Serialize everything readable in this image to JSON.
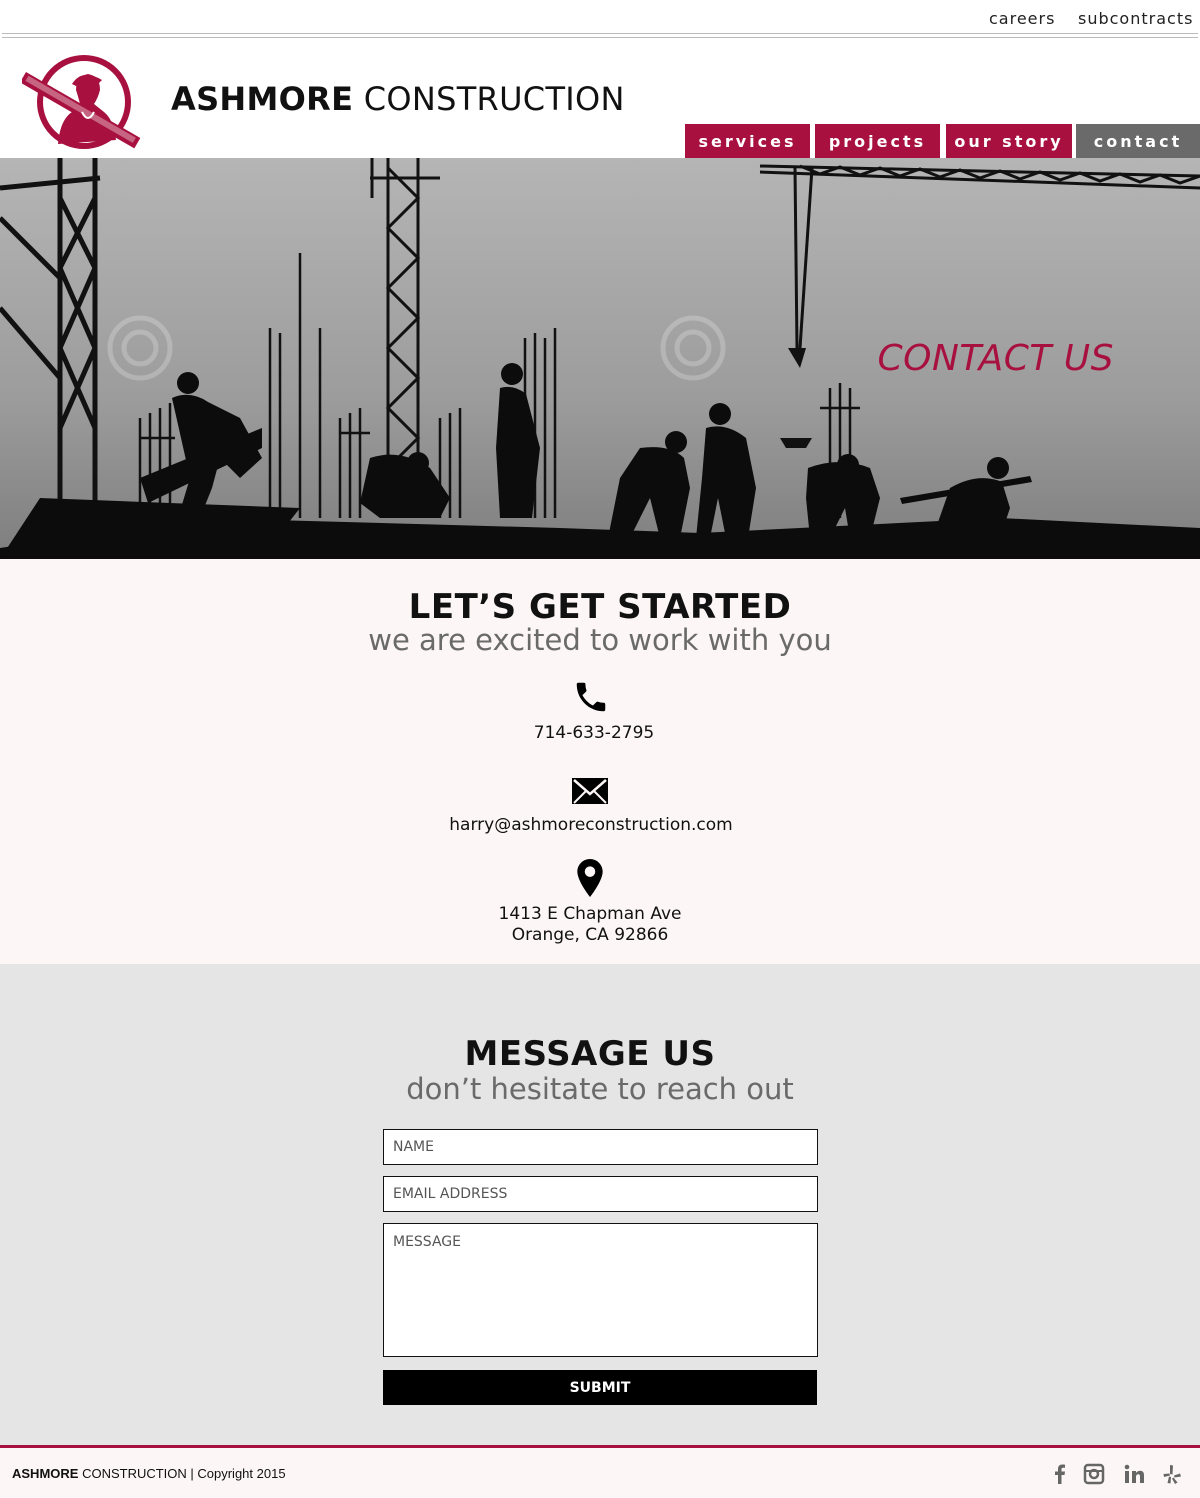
{
  "topbar": {
    "careers": "careers",
    "subcontracts": "subcontracts"
  },
  "header": {
    "brand_bold": "ASHMORE",
    "brand_light": " CONSTRUCTION"
  },
  "nav": {
    "items": [
      {
        "label": "services"
      },
      {
        "label": "projects"
      },
      {
        "label": "our story"
      },
      {
        "label": "contact"
      }
    ],
    "active": "contact"
  },
  "hero": {
    "title": "CONTACT US"
  },
  "contact": {
    "title": "LET’S GET STARTED",
    "subtitle": "we are excited to work with you",
    "phone": "714-633-2795",
    "email": "harry@ashmoreconstruction.com",
    "address_line1": "1413 E Chapman Ave",
    "address_line2": "Orange, CA 92866"
  },
  "message": {
    "title": "MESSAGE US",
    "subtitle": "don’t hesitate to reach out",
    "name_placeholder": "NAME",
    "email_placeholder": "EMAIL ADDRESS",
    "message_placeholder": "MESSAGE",
    "submit_label": "SUBMIT"
  },
  "footer": {
    "brand_bold": "ASHMORE",
    "brand_rest": " CONSTRUCTION | Copyright 2015",
    "social": [
      "facebook-icon",
      "instagram-icon",
      "linkedin-icon",
      "yelp-icon"
    ]
  },
  "colors": {
    "brand": "#a8113f",
    "nav_active": "#6a6a6a",
    "contact_bg": "#fdf6f6",
    "form_bg": "#e5e5e5"
  }
}
